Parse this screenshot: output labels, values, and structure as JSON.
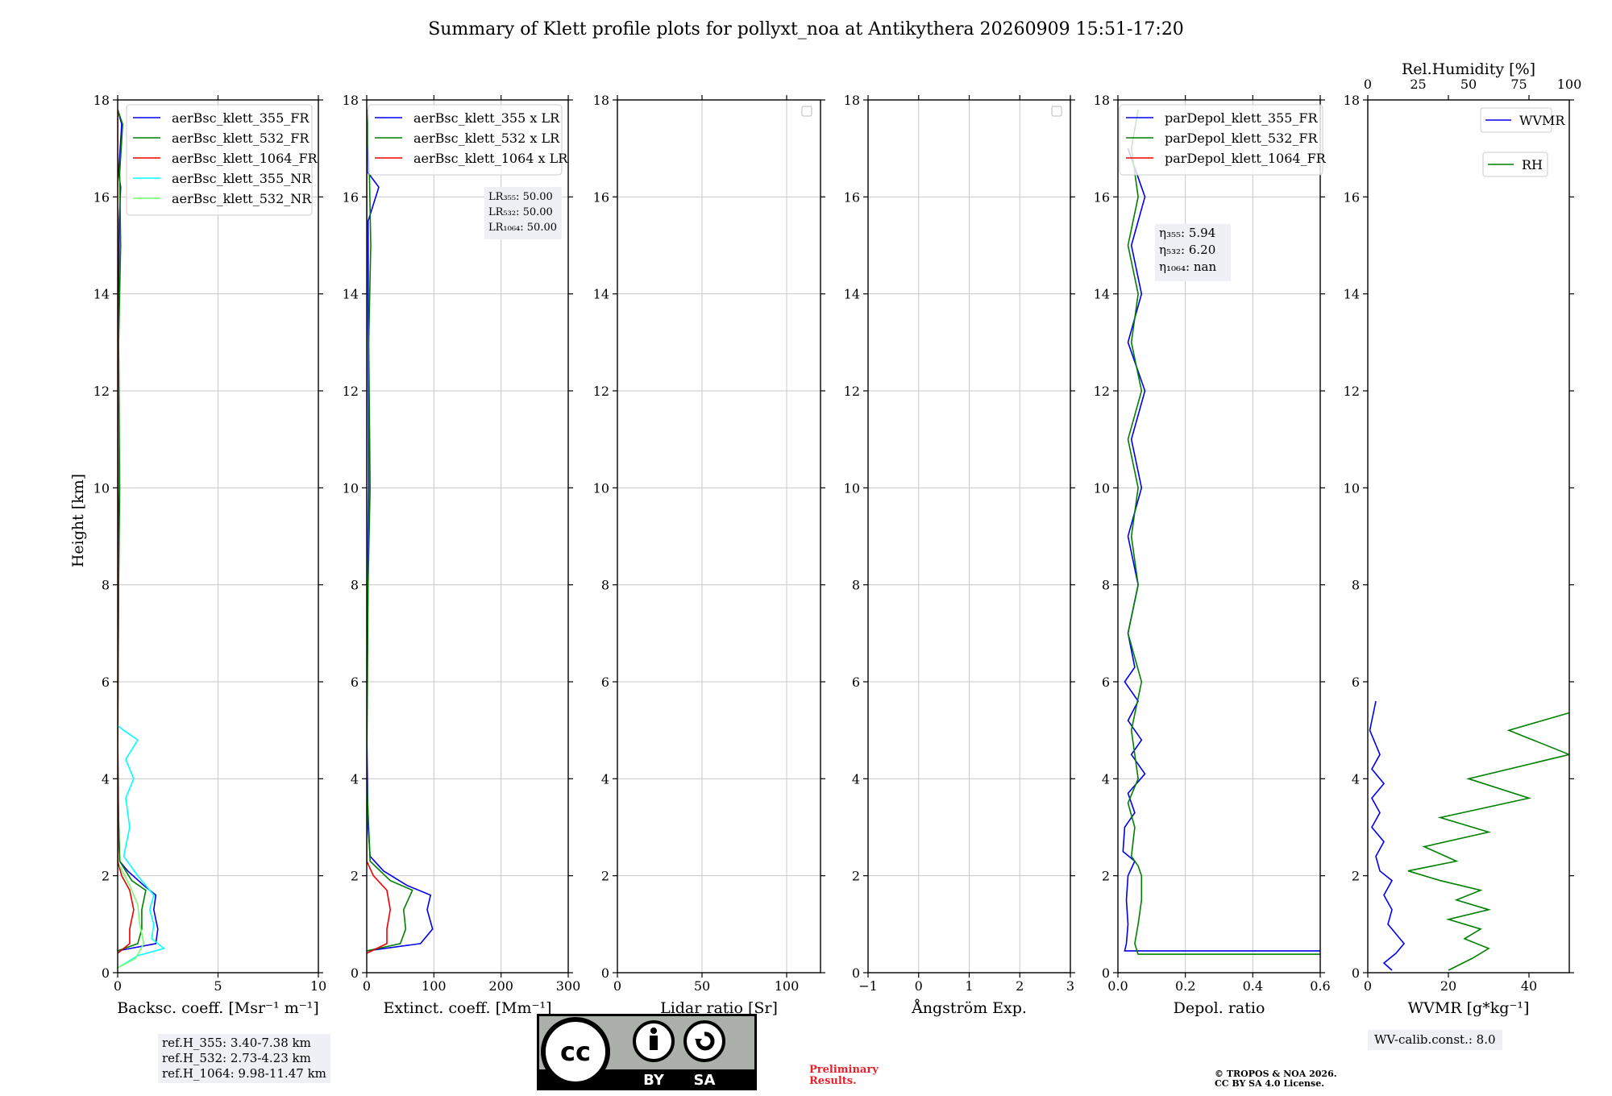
{
  "figure_title": "Summary of Klett profile plots for pollyxt_noa at Antikythera 20260909 15:51-17:20",
  "ylabel": "Height [km]",
  "colors": {
    "b355": "#0000ee",
    "g532": "#008000",
    "r1064": "#ee0000",
    "c355nr": "#00ffff",
    "lg532nr": "#6fff6f"
  },
  "chart_data": [
    {
      "type": "line",
      "xlabel": "Backsc. coeff. [Msr⁻¹ m⁻¹]",
      "xlim": [
        0,
        10
      ],
      "ylim": [
        0,
        18
      ],
      "xticks": [
        "0",
        "5",
        "10"
      ],
      "yticks": [
        "0",
        "2",
        "4",
        "6",
        "8",
        "10",
        "12",
        "14",
        "16",
        "18"
      ],
      "grid": true,
      "legend": {
        "placement": "top-right",
        "entries": [
          "aerBsc_klett_355_FR",
          "aerBsc_klett_532_FR",
          "aerBsc_klett_1064_FR",
          "aerBsc_klett_355_NR",
          "aerBsc_klett_532_NR"
        ]
      },
      "series": [
        {
          "name": "aerBsc_klett_355_FR",
          "color": "b355",
          "points": [
            [
              0,
              0.45
            ],
            [
              1.9,
              0.6
            ],
            [
              2.0,
              0.9
            ],
            [
              1.8,
              1.3
            ],
            [
              1.9,
              1.6
            ],
            [
              1.3,
              1.8
            ],
            [
              0.5,
              2.1
            ],
            [
              0.1,
              2.3
            ],
            [
              0.05,
              3
            ],
            [
              0,
              5
            ],
            [
              0.05,
              8
            ],
            [
              0,
              12
            ],
            [
              0.08,
              15.5
            ],
            [
              0.15,
              16.2
            ],
            [
              0.05,
              16.5
            ],
            [
              0.2,
              17.5
            ],
            [
              0,
              17.8
            ]
          ]
        },
        {
          "name": "aerBsc_klett_532_FR",
          "color": "g532",
          "points": [
            [
              0,
              0.45
            ],
            [
              1.0,
              0.6
            ],
            [
              1.2,
              0.9
            ],
            [
              1.2,
              1.3
            ],
            [
              1.4,
              1.7
            ],
            [
              0.7,
              1.9
            ],
            [
              0.1,
              2.3
            ],
            [
              0,
              4
            ],
            [
              0.05,
              8
            ],
            [
              0.1,
              10
            ],
            [
              0.05,
              13
            ],
            [
              0.15,
              15
            ],
            [
              0.1,
              16.5
            ],
            [
              0.25,
              17.5
            ],
            [
              0,
              17.8
            ]
          ]
        },
        {
          "name": "aerBsc_klett_1064_FR",
          "color": "r1064",
          "points": [
            [
              0,
              0.4
            ],
            [
              0.6,
              0.6
            ],
            [
              0.6,
              0.9
            ],
            [
              0.8,
              1.3
            ],
            [
              0.6,
              1.7
            ],
            [
              0.2,
              2.0
            ],
            [
              0,
              2.3
            ],
            [
              0,
              17.8
            ]
          ]
        },
        {
          "name": "aerBsc_klett_355_NR",
          "color": "c355nr",
          "points": [
            [
              0,
              0.1
            ],
            [
              1.0,
              0.35
            ],
            [
              2.3,
              0.5
            ],
            [
              1.7,
              0.7
            ],
            [
              1.8,
              1.0
            ],
            [
              1.6,
              1.3
            ],
            [
              1.8,
              1.6
            ],
            [
              1.0,
              2.0
            ],
            [
              0.3,
              2.4
            ],
            [
              0.6,
              3.0
            ],
            [
              0.4,
              3.6
            ],
            [
              0.8,
              4.0
            ],
            [
              0.4,
              4.4
            ],
            [
              1.0,
              4.8
            ],
            [
              0.3,
              5.0
            ],
            [
              0,
              5.1
            ]
          ]
        },
        {
          "name": "aerBsc_klett_532_NR",
          "color": "lg532nr",
          "points": [
            [
              0,
              0.1
            ],
            [
              0.9,
              0.3
            ],
            [
              1.3,
              0.6
            ],
            [
              1.1,
              1.0
            ],
            [
              1.0,
              1.4
            ],
            [
              0.6,
              1.8
            ],
            [
              0.1,
              2.2
            ]
          ]
        }
      ]
    },
    {
      "type": "line",
      "xlabel": "Extinct. coeff. [Mm⁻¹]",
      "xlim": [
        0,
        300
      ],
      "ylim": [
        0,
        18
      ],
      "xticks": [
        "0",
        "100",
        "200",
        "300"
      ],
      "yticks": [
        "0",
        "2",
        "4",
        "6",
        "8",
        "10",
        "12",
        "14",
        "16",
        "18"
      ],
      "grid": true,
      "legend": {
        "placement": "top-right",
        "entries": [
          "aerBsc_klett_355 x LR",
          "aerBsc_klett_532 x LR",
          "aerBsc_klett_1064 x LR"
        ]
      },
      "annotation": [
        "LR₃₅₅: 50.00",
        "LR₅₃₂: 50.00",
        "LR₁₀₆₄: 50.00"
      ],
      "series": [
        {
          "name": "aerBsc_klett_355 x LR",
          "color": "b355",
          "points": [
            [
              0,
              0.45
            ],
            [
              80,
              0.6
            ],
            [
              98,
              0.9
            ],
            [
              90,
              1.3
            ],
            [
              95,
              1.6
            ],
            [
              60,
              1.8
            ],
            [
              25,
              2.1
            ],
            [
              5,
              2.4
            ],
            [
              2,
              3
            ],
            [
              0,
              5
            ],
            [
              3,
              10
            ],
            [
              2,
              15.5
            ],
            [
              18,
              16.2
            ],
            [
              2,
              16.5
            ],
            [
              0,
              17.8
            ]
          ]
        },
        {
          "name": "aerBsc_klett_532 x LR",
          "color": "g532",
          "points": [
            [
              0,
              0.45
            ],
            [
              50,
              0.6
            ],
            [
              58,
              0.9
            ],
            [
              55,
              1.3
            ],
            [
              68,
              1.7
            ],
            [
              35,
              1.9
            ],
            [
              5,
              2.3
            ],
            [
              0,
              4
            ],
            [
              2,
              8
            ],
            [
              5,
              10
            ],
            [
              3,
              13
            ],
            [
              6,
              15
            ],
            [
              4,
              16.5
            ],
            [
              0,
              17.8
            ]
          ]
        },
        {
          "name": "aerBsc_klett_1064 x LR",
          "color": "r1064",
          "points": [
            [
              0,
              0.4
            ],
            [
              30,
              0.6
            ],
            [
              30,
              0.9
            ],
            [
              35,
              1.3
            ],
            [
              30,
              1.7
            ],
            [
              10,
              2.0
            ],
            [
              0,
              2.3
            ],
            [
              0,
              17.8
            ]
          ]
        }
      ]
    },
    {
      "type": "line",
      "xlabel": "Lidar ratio [Sr]",
      "xlim": [
        0,
        120
      ],
      "ylim": [
        0,
        18
      ],
      "xticks": [
        "0",
        "50",
        "100"
      ],
      "yticks": [
        "0",
        "2",
        "4",
        "6",
        "8",
        "10",
        "12",
        "14",
        "16",
        "18"
      ],
      "grid": true,
      "legend": {
        "placement": "top-right",
        "entries": []
      },
      "series": []
    },
    {
      "type": "line",
      "xlabel": "Ångström Exp.",
      "xlim": [
        -1,
        3
      ],
      "ylim": [
        0,
        18
      ],
      "xticks": [
        "−1",
        "0",
        "1",
        "2",
        "3"
      ],
      "yticks": [
        "0",
        "2",
        "4",
        "6",
        "8",
        "10",
        "12",
        "14",
        "16",
        "18"
      ],
      "grid": true,
      "legend": {
        "placement": "top-right",
        "entries": []
      },
      "series": []
    },
    {
      "type": "line",
      "xlabel": "Depol. ratio",
      "xlim": [
        0,
        0.6
      ],
      "ylim": [
        0,
        18
      ],
      "xticks": [
        "0.0",
        "0.2",
        "0.4",
        "0.6"
      ],
      "yticks": [
        "0",
        "2",
        "4",
        "6",
        "8",
        "10",
        "12",
        "14",
        "16",
        "18"
      ],
      "grid": true,
      "legend": {
        "placement": "top-left",
        "entries": [
          "parDepol_klett_355_FR",
          "parDepol_klett_532_FR",
          "parDepol_klett_1064_FR"
        ]
      },
      "annotation": [
        "η₃₅₅: 5.94",
        "η₅₃₂: 6.20",
        "η₁₀₆₄: nan"
      ],
      "series": [
        {
          "name": "parDepol_klett_355_FR",
          "color": "b355",
          "points": [
            [
              0.6,
              0.45
            ],
            [
              0.02,
              0.45
            ],
            [
              0.025,
              0.6
            ],
            [
              0.03,
              1.0
            ],
            [
              0.025,
              1.5
            ],
            [
              0.03,
              2.0
            ],
            [
              0.05,
              2.3
            ],
            [
              0.015,
              2.5
            ],
            [
              0.02,
              3.0
            ],
            [
              0.05,
              3.3
            ],
            [
              0.03,
              3.7
            ],
            [
              0.08,
              4.1
            ],
            [
              0.04,
              4.5
            ],
            [
              0.07,
              4.8
            ],
            [
              0.03,
              5.2
            ],
            [
              0.06,
              5.6
            ],
            [
              0.02,
              6.0
            ],
            [
              0.05,
              6.3
            ],
            [
              0.03,
              7.0
            ],
            [
              0.06,
              8.0
            ],
            [
              0.03,
              9.0
            ],
            [
              0.07,
              10.0
            ],
            [
              0.04,
              11.0
            ],
            [
              0.08,
              12.0
            ],
            [
              0.03,
              13.0
            ],
            [
              0.07,
              14.0
            ],
            [
              0.04,
              15.0
            ],
            [
              0.08,
              16.0
            ],
            [
              0.03,
              17.0
            ]
          ]
        },
        {
          "name": "parDepol_klett_532_FR",
          "color": "g532",
          "points": [
            [
              0.6,
              0.38
            ],
            [
              0.06,
              0.38
            ],
            [
              0.05,
              0.6
            ],
            [
              0.06,
              1.0
            ],
            [
              0.07,
              1.5
            ],
            [
              0.07,
              2.0
            ],
            [
              0.06,
              2.2
            ],
            [
              0.04,
              2.4
            ],
            [
              0.05,
              3.0
            ],
            [
              0.03,
              3.5
            ],
            [
              0.06,
              4.0
            ],
            [
              0.04,
              5.0
            ],
            [
              0.07,
              6.0
            ],
            [
              0.03,
              7.0
            ],
            [
              0.06,
              8.0
            ],
            [
              0.04,
              9.0
            ],
            [
              0.06,
              10.0
            ],
            [
              0.03,
              11.0
            ],
            [
              0.07,
              12.0
            ],
            [
              0.04,
              13.0
            ],
            [
              0.06,
              14.0
            ],
            [
              0.03,
              15.0
            ],
            [
              0.06,
              16.0
            ],
            [
              0.04,
              17.0
            ],
            [
              0.06,
              17.8
            ]
          ]
        },
        {
          "name": "parDepol_klett_1064_FR",
          "color": "r1064",
          "points": []
        }
      ]
    },
    {
      "type": "line",
      "xlabel": "WVMR [g*kg⁻¹]",
      "xlabel_top": "Rel.Humidity [%]",
      "xlim": [
        0,
        50
      ],
      "xlim_top": [
        0,
        100
      ],
      "ylim": [
        0,
        18
      ],
      "xticks": [
        "0",
        "20",
        "40"
      ],
      "xticks_top": [
        "0",
        "25",
        "50",
        "75",
        "100"
      ],
      "yticks": [
        "0",
        "2",
        "4",
        "6",
        "8",
        "10",
        "12",
        "14",
        "16",
        "18"
      ],
      "grid": false,
      "legend": {
        "placement": "top-right",
        "entries": [
          "WVMR",
          "RH"
        ]
      },
      "series": [
        {
          "name": "WVMR",
          "color": "b355",
          "points": [
            [
              6,
              0.05
            ],
            [
              4,
              0.2
            ],
            [
              7,
              0.4
            ],
            [
              9,
              0.6
            ],
            [
              7,
              0.8
            ],
            [
              5,
              1.0
            ],
            [
              6,
              1.3
            ],
            [
              4,
              1.6
            ],
            [
              6,
              1.9
            ],
            [
              3,
              2.1
            ],
            [
              2,
              2.4
            ],
            [
              4,
              2.7
            ],
            [
              1,
              3.0
            ],
            [
              3,
              3.3
            ],
            [
              1,
              3.6
            ],
            [
              4,
              3.9
            ],
            [
              1,
              4.2
            ],
            [
              3,
              4.5
            ],
            [
              0.5,
              5.0
            ],
            [
              2,
              5.6
            ]
          ]
        },
        {
          "name": "RH",
          "color": "g532",
          "points": [
            [
              20,
              0.05
            ],
            [
              26,
              0.3
            ],
            [
              30,
              0.5
            ],
            [
              24,
              0.7
            ],
            [
              28,
              0.9
            ],
            [
              20,
              1.1
            ],
            [
              30,
              1.3
            ],
            [
              22,
              1.5
            ],
            [
              28,
              1.7
            ],
            [
              18,
              1.9
            ],
            [
              10,
              2.1
            ],
            [
              22,
              2.3
            ],
            [
              14,
              2.6
            ],
            [
              30,
              2.9
            ],
            [
              18,
              3.2
            ],
            [
              40,
              3.6
            ],
            [
              25,
              4.0
            ],
            [
              50,
              4.5
            ],
            [
              35,
              5.0
            ],
            [
              60,
              5.6
            ]
          ]
        }
      ]
    }
  ],
  "info": {
    "refh_355": "ref.H_355: 3.40-7.38 km",
    "refh_532": "ref.H_532: 2.73-4.23 km",
    "refh_1064": "ref.H_1064: 9.98-11.47 km",
    "wv_calib": "WV-calib.const.: 8.0",
    "prelim_1": "Preliminary",
    "prelim_2": "Results.",
    "copyright_1": "© TROPOS & NOA 2026.",
    "copyright_2": "CC BY SA 4.0 License.",
    "cc_logo_text": "CC BY SA"
  }
}
